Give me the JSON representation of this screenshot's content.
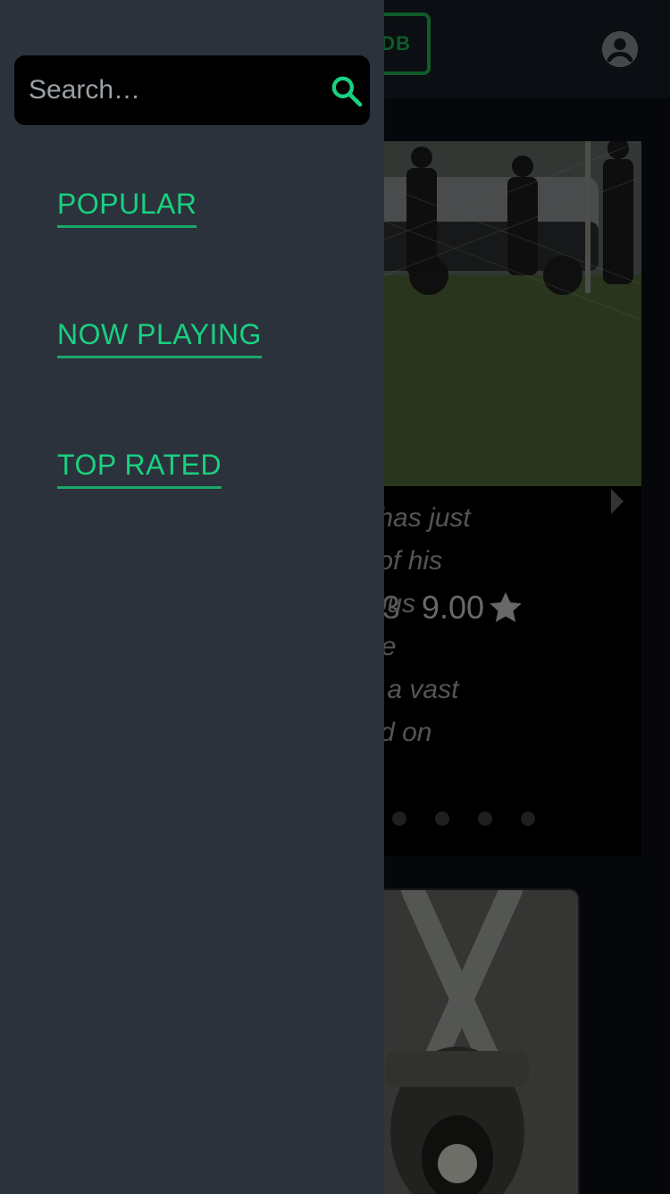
{
  "header": {
    "logo_text": "DB",
    "account_icon": "account-circle-icon"
  },
  "hero": {
    "meta_partial": "3",
    "rating": "9.00",
    "rating_icon": "star-icon",
    "overview_partial": "Rosser has just\n murder of his\nmysterious\ngates the\nncovers a vast\nhokehold on\nourne...",
    "carousel_dots": 4
  },
  "drawer": {
    "search": {
      "placeholder": "Search…",
      "value": "",
      "icon": "search-icon"
    },
    "nav": [
      {
        "label": "POPULAR"
      },
      {
        "label": "NOW PLAYING"
      },
      {
        "label": "TOP RATED"
      }
    ]
  },
  "colors": {
    "accent": "#19d180",
    "drawer_bg": "#2b323c",
    "brand_logo": "#1ea64e"
  }
}
